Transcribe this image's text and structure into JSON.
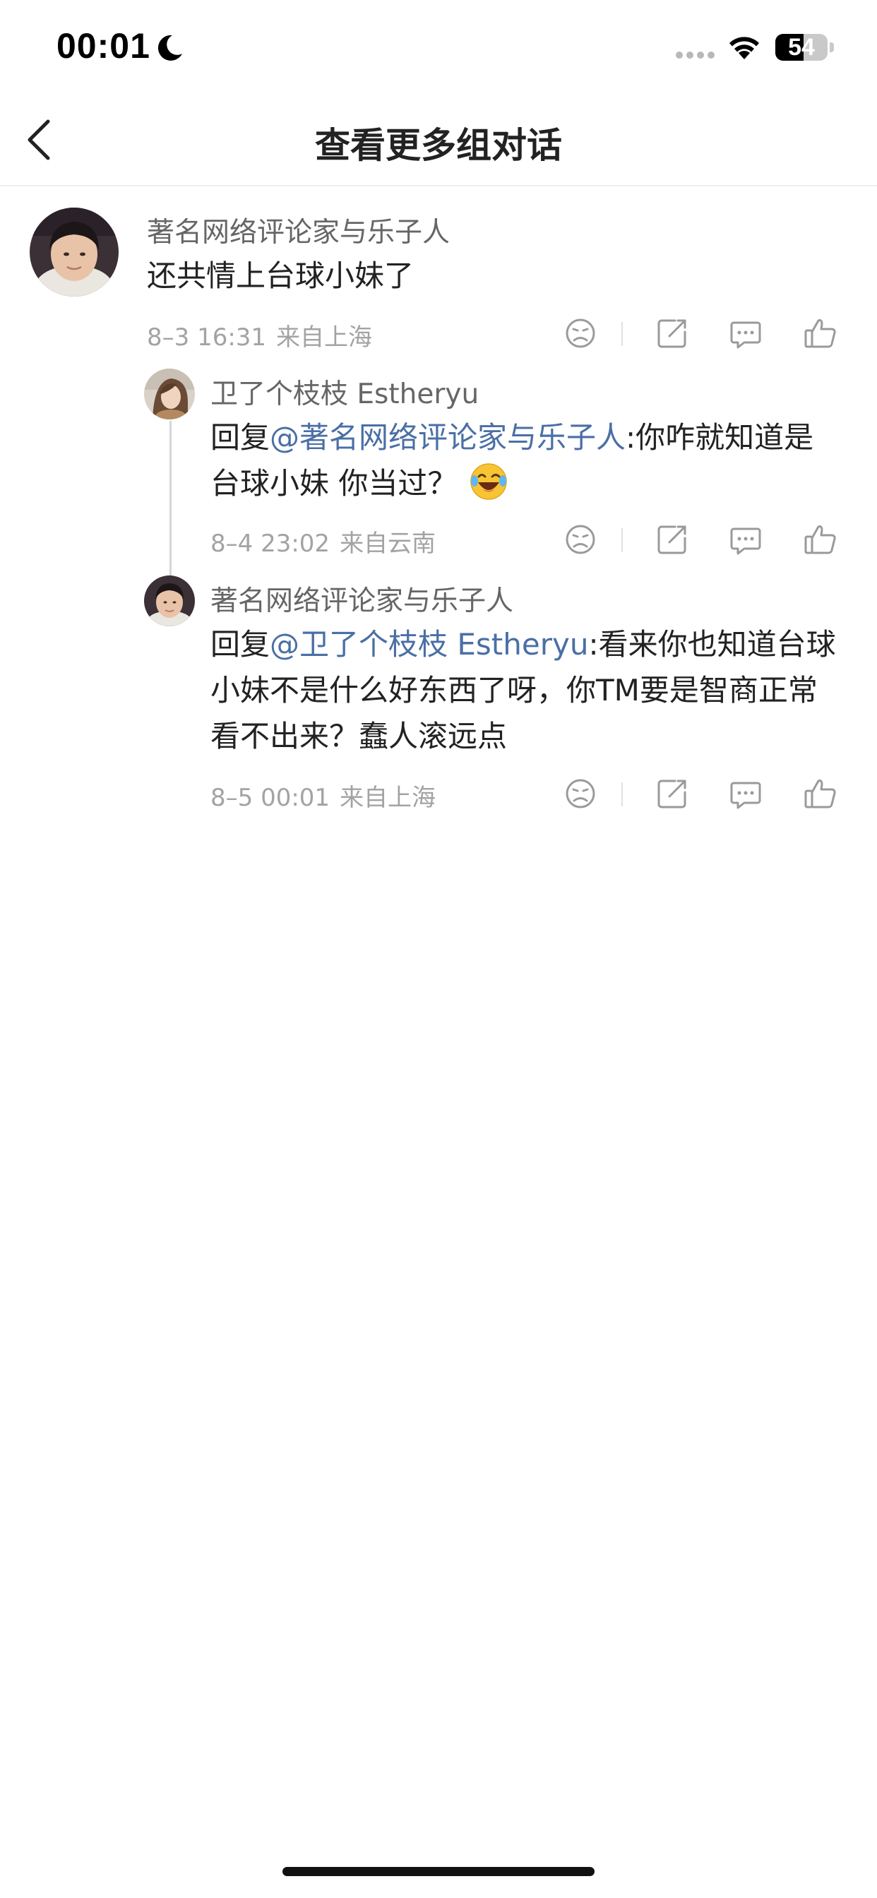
{
  "status_bar": {
    "time": "00:01",
    "battery": "54",
    "battery_fraction": 0.54,
    "icons": [
      "moon-icon",
      "signal-icon",
      "wifi-icon",
      "battery-icon"
    ]
  },
  "nav": {
    "back_icon": "chevron-left-icon",
    "title": "查看更多组对话"
  },
  "comments": [
    {
      "username": "著名网络评论家与乐子人",
      "text": "还共情上台球小妹了",
      "date": "8–3 16:31",
      "location": "来自上海"
    },
    {
      "username": "卫了个枝枝 Estheryu",
      "reply_prefix": "回复",
      "mention": "@著名网络评论家与乐子人",
      "text": ":你咋就知道是台球小妹 你当过？",
      "emoji": "laughing-crying-emoji",
      "date": "8–4 23:02",
      "location": "来自云南"
    },
    {
      "username": "著名网络评论家与乐子人",
      "reply_prefix": "回复",
      "mention": "@卫了个枝枝 Estheryu",
      "text": ":看来你也知道台球小妹不是什么好东西了呀，你TM要是智商正常看不出来？蠢人滚远点",
      "date": "8–5 00:01",
      "location": "来自上海"
    }
  ],
  "action_icons": [
    "dislike-icon",
    "share-icon",
    "reply-icon",
    "like-icon"
  ],
  "colors": {
    "mention": "#4a6fa5",
    "meta_text": "#a3a3a3",
    "username": "#666666",
    "body_text": "#222222"
  }
}
